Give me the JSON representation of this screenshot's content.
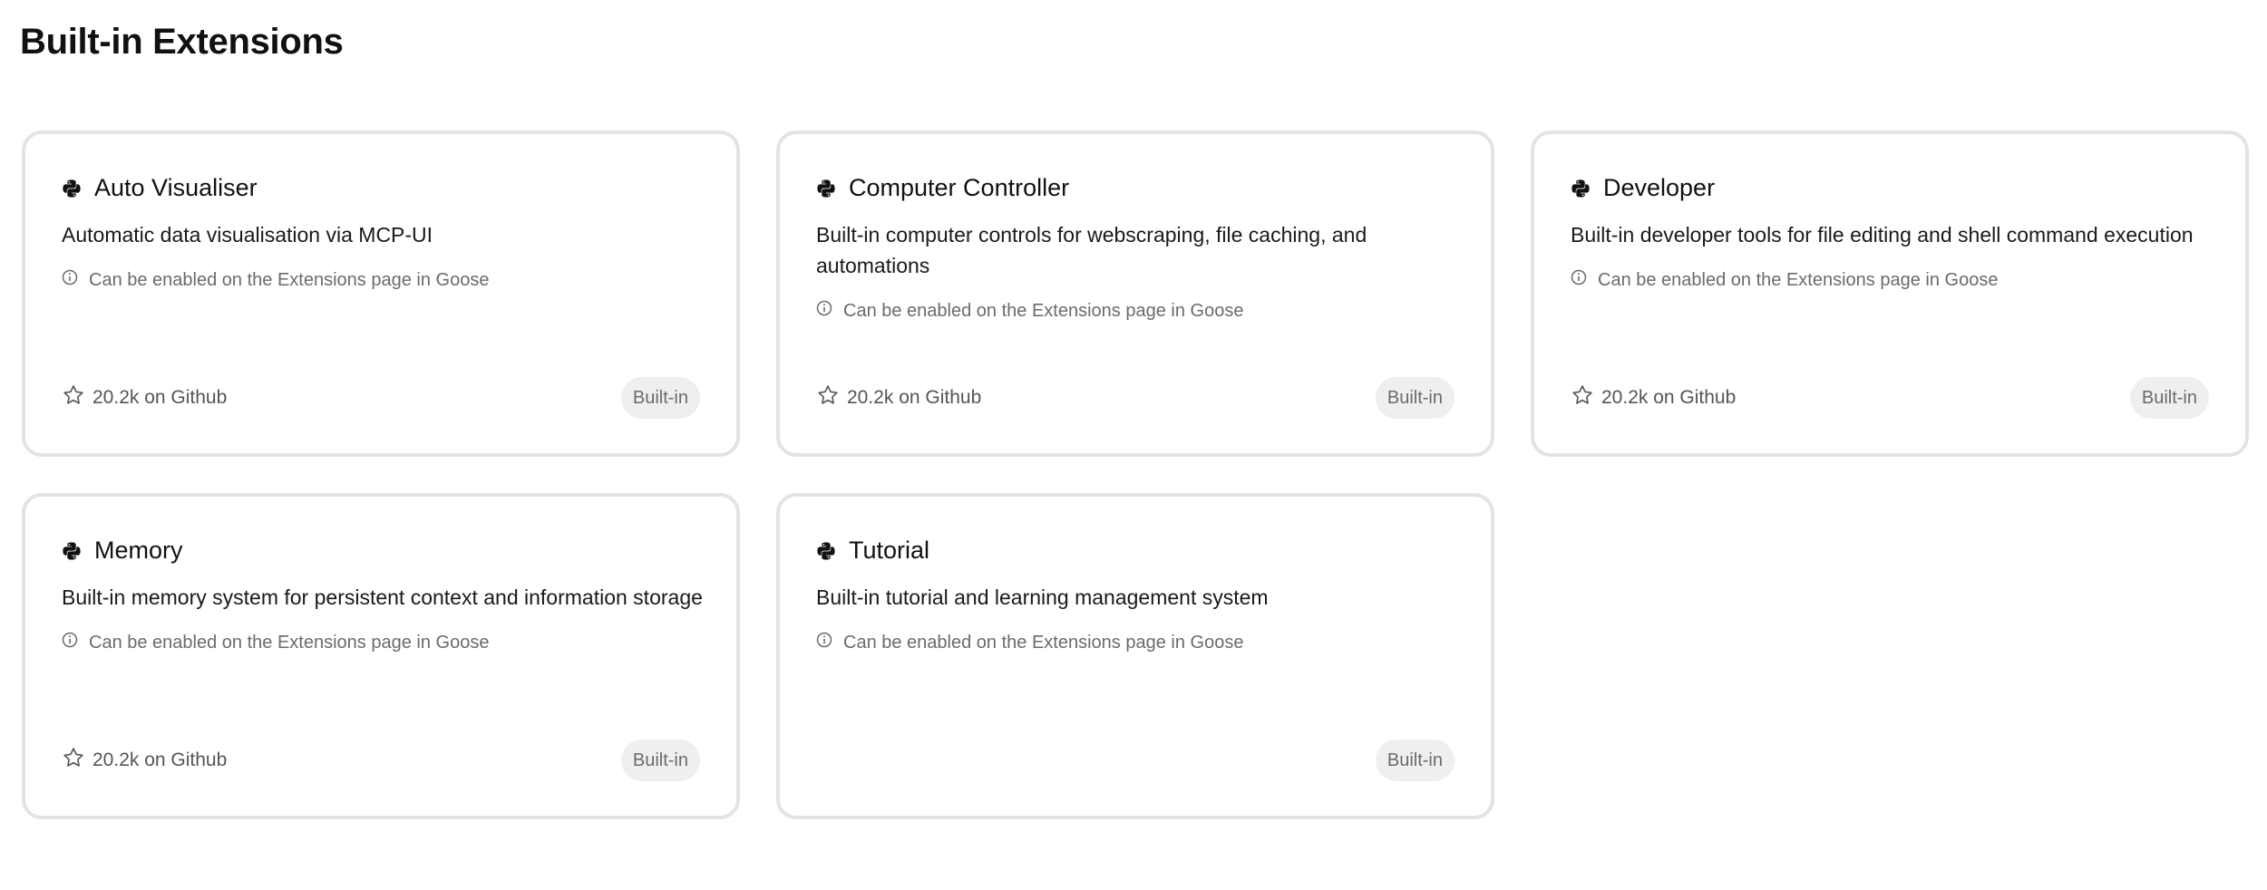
{
  "page": {
    "title": "Built-in Extensions"
  },
  "colors": {
    "card_border": "#e3e3e3",
    "badge_bg": "#efefef",
    "muted_text": "#6b6b6b"
  },
  "cards": [
    {
      "name": "Auto Visualiser",
      "icon": "python-icon",
      "description": "Automatic data visualisation via MCP-UI",
      "note": "Can be enabled on the Extensions page in Goose",
      "stars": "20.2k on Github",
      "badge": "Built-in"
    },
    {
      "name": "Computer Controller",
      "icon": "python-icon",
      "description": "Built-in computer controls for webscraping, file caching, and automations",
      "note": "Can be enabled on the Extensions page in Goose",
      "stars": "20.2k on Github",
      "badge": "Built-in"
    },
    {
      "name": "Developer",
      "icon": "python-icon",
      "description": "Built-in developer tools for file editing and shell command execution",
      "note": "Can be enabled on the Extensions page in Goose",
      "stars": "20.2k on Github",
      "badge": "Built-in"
    },
    {
      "name": "Memory",
      "icon": "python-icon",
      "description": "Built-in memory system for persistent context and information storage",
      "note": "Can be enabled on the Extensions page in Goose",
      "stars": "20.2k on Github",
      "badge": "Built-in"
    },
    {
      "name": "Tutorial",
      "icon": "python-icon",
      "description": "Built-in tutorial and learning management system",
      "note": "Can be enabled on the Extensions page in Goose",
      "badge": "Built-in"
    }
  ]
}
